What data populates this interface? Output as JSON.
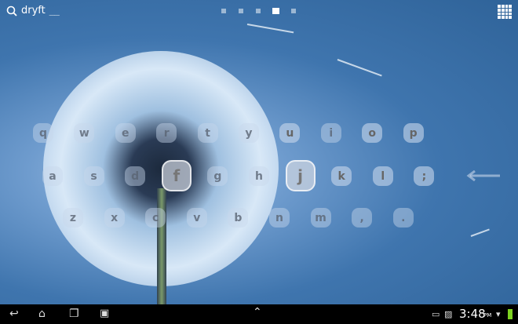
{
  "search": {
    "text": "dryft"
  },
  "pages": {
    "count": 5,
    "active": 3
  },
  "keyboard": {
    "row1": [
      "q",
      "w",
      "e",
      "r",
      "t",
      "y",
      "u",
      "i",
      "o",
      "p"
    ],
    "row2": [
      "a",
      "s",
      "d",
      "f",
      "g",
      "h",
      "j",
      "k",
      "l",
      ";"
    ],
    "row3": [
      "z",
      "x",
      "c",
      "v",
      "b",
      "n",
      "m",
      ",",
      "."
    ],
    "highlighted": [
      "f",
      "j"
    ]
  },
  "status": {
    "time": "3:48",
    "ampm": "PM",
    "battery_color": "#7ed321"
  }
}
